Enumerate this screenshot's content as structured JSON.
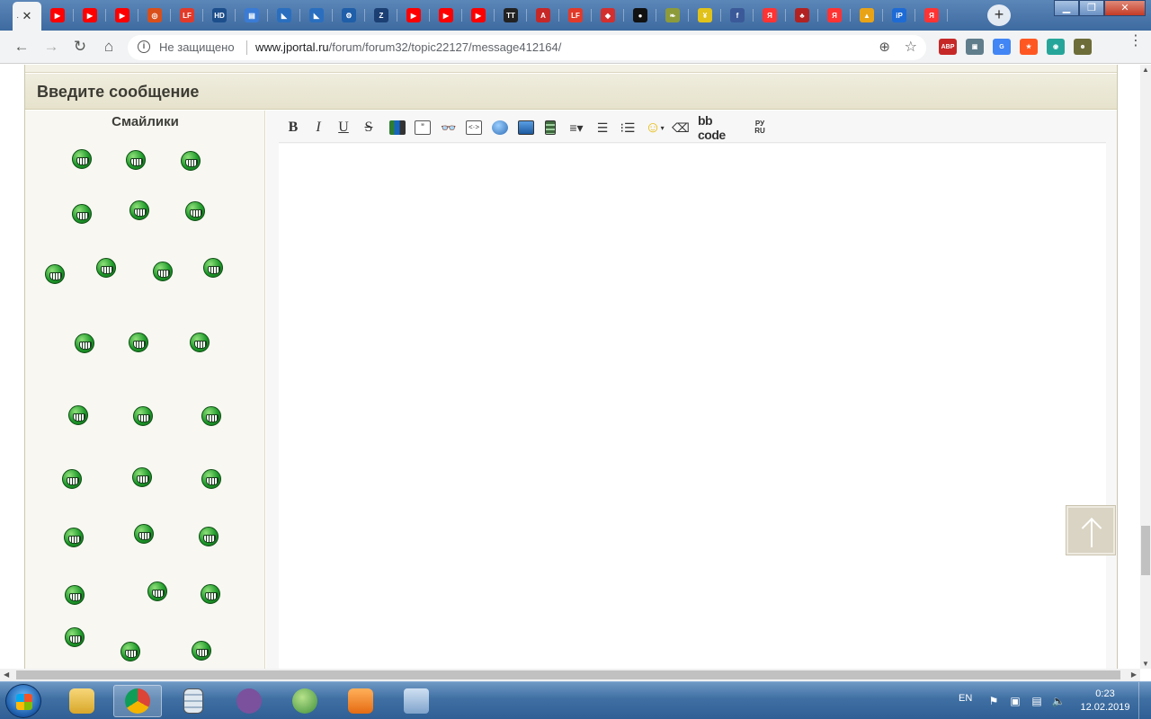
{
  "browser": {
    "favicons": [
      {
        "name": "youtube",
        "color": "#ff0000",
        "glyph": "▶"
      },
      {
        "name": "youtube",
        "color": "#ff0000",
        "glyph": "▶"
      },
      {
        "name": "youtube",
        "color": "#ff0000",
        "glyph": "▶"
      },
      {
        "name": "target",
        "color": "#d94f1a",
        "glyph": "◎"
      },
      {
        "name": "lf",
        "color": "#e23a2a",
        "glyph": "LF"
      },
      {
        "name": "hd",
        "color": "#1c4e8c",
        "glyph": "HD"
      },
      {
        "name": "book",
        "color": "#3a7bd5",
        "glyph": "▤"
      },
      {
        "name": "shark",
        "color": "#2a6fbf",
        "glyph": "◣"
      },
      {
        "name": "shark",
        "color": "#2a6fbf",
        "glyph": "◣"
      },
      {
        "name": "gear",
        "color": "#1f5ea8",
        "glyph": "⚙"
      },
      {
        "name": "zigzag",
        "color": "#1b3f73",
        "glyph": "Z"
      },
      {
        "name": "youtube",
        "color": "#ff0000",
        "glyph": "▶"
      },
      {
        "name": "youtube",
        "color": "#ff0000",
        "glyph": "▶"
      },
      {
        "name": "youtube",
        "color": "#ff0000",
        "glyph": "▶"
      },
      {
        "name": "tt",
        "color": "#222222",
        "glyph": "TT"
      },
      {
        "name": "a-red",
        "color": "#c62828",
        "glyph": "A"
      },
      {
        "name": "lf",
        "color": "#e23a2a",
        "glyph": "LF"
      },
      {
        "name": "diamond",
        "color": "#d32f2f",
        "glyph": "◆"
      },
      {
        "name": "dot",
        "color": "#111111",
        "glyph": "●"
      },
      {
        "name": "leaf",
        "color": "#8d9b3a",
        "glyph": "❧"
      },
      {
        "name": "yellow",
        "color": "#e0c21a",
        "glyph": "¥"
      },
      {
        "name": "facebook",
        "color": "#3b5998",
        "glyph": "f"
      },
      {
        "name": "yandex",
        "color": "#ff3333",
        "glyph": "Я"
      },
      {
        "name": "cards",
        "color": "#b22222",
        "glyph": "♣"
      },
      {
        "name": "yandex",
        "color": "#ff3333",
        "glyph": "Я"
      },
      {
        "name": "picture",
        "color": "#e8a317",
        "glyph": "▲"
      },
      {
        "name": "ip",
        "color": "#1e6bd6",
        "glyph": "iP"
      },
      {
        "name": "yandex",
        "color": "#ff3333",
        "glyph": "Я"
      }
    ],
    "security_label": "Не защищено",
    "url_domain": "www.jportal.ru",
    "url_path": "/forum/forum32/topic22127/message412164/",
    "extensions": [
      {
        "name": "abp",
        "color": "#c62828",
        "glyph": "ABP"
      },
      {
        "name": "monitor",
        "color": "#607d8b",
        "glyph": "▣"
      },
      {
        "name": "translate",
        "color": "#4285f4",
        "glyph": "G"
      },
      {
        "name": "shield",
        "color": "#ff5722",
        "glyph": "★"
      },
      {
        "name": "box",
        "color": "#26a69a",
        "glyph": "◉"
      },
      {
        "name": "avatar",
        "color": "#6d6d3a",
        "glyph": "☻"
      }
    ]
  },
  "form": {
    "title": "Введите сообщение",
    "smileys_title": "Смайлики",
    "message_text": "",
    "toolbar": {
      "bold": "B",
      "italic": "I",
      "underline": "U",
      "strike": "S",
      "bbcode": "bb code",
      "rus_top": "РУ",
      "rus_bottom": "RU"
    },
    "smiley_count": 28
  },
  "taskbar": {
    "language": "EN",
    "time": "0:23",
    "date": "12.02.2019"
  }
}
